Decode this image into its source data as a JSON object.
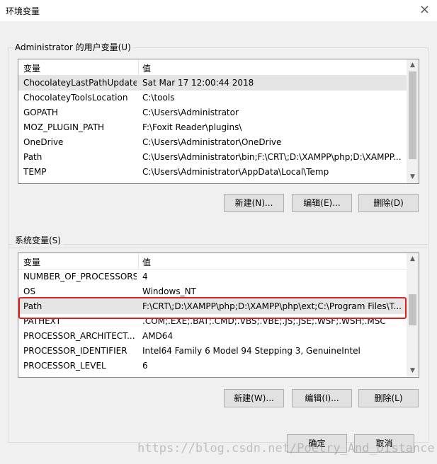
{
  "window": {
    "title": "环境变量",
    "close_label": "×"
  },
  "user_vars": {
    "group_label": "Administrator 的用户变量(U)",
    "col_var": "变量",
    "col_val": "值",
    "rows": [
      {
        "name": "ChocolateyLastPathUpdate",
        "value": "Sat Mar 17 12:00:44 2018"
      },
      {
        "name": "ChocolateyToolsLocation",
        "value": "C:\\tools"
      },
      {
        "name": "GOPATH",
        "value": "C:\\Users\\Administrator"
      },
      {
        "name": "MOZ_PLUGIN_PATH",
        "value": "F:\\Foxit Reader\\plugins\\"
      },
      {
        "name": "OneDrive",
        "value": "C:\\Users\\Administrator\\OneDrive"
      },
      {
        "name": "Path",
        "value": "C:\\Users\\Administrator\\bin;F:\\CRT\\;D:\\XAMPP\\php;D:\\XAMPP..."
      },
      {
        "name": "TEMP",
        "value": "C:\\Users\\Administrator\\AppData\\Local\\Temp"
      }
    ],
    "new_button": "新建(N)...",
    "edit_button": "编辑(E)...",
    "delete_button": "删除(D)"
  },
  "system_vars": {
    "group_label": "系统变量(S)",
    "col_var": "变量",
    "col_val": "值",
    "rows": [
      {
        "name": "NUMBER_OF_PROCESSORS",
        "value": "4"
      },
      {
        "name": "OS",
        "value": "Windows_NT"
      },
      {
        "name": "Path",
        "value": "F:\\CRT\\;D:\\XAMPP\\php;D:\\XAMPP\\php\\ext;C:\\Program Files\\T..."
      },
      {
        "name": "PATHEXT",
        "value": ".COM;.EXE;.BAT;.CMD;.VBS;.VBE;.JS;.JSE;.WSF;.WSH;.MSC"
      },
      {
        "name": "PROCESSOR_ARCHITECT...",
        "value": "AMD64"
      },
      {
        "name": "PROCESSOR_IDENTIFIER",
        "value": "Intel64 Family 6 Model 94 Stepping 3, GenuineIntel"
      },
      {
        "name": "PROCESSOR_LEVEL",
        "value": "6"
      }
    ],
    "new_button": "新建(W)...",
    "edit_button": "编辑(I)...",
    "delete_button": "删除(L)"
  },
  "footer": {
    "ok_button": "确定",
    "cancel_button": "取消"
  },
  "watermark": "https://blog.csdn.net/Poetry_And_Distance",
  "colors": {
    "highlight": "#e0201c",
    "dialog_bg": "#f0f0f0",
    "selected_row": "#e5e5e5"
  }
}
